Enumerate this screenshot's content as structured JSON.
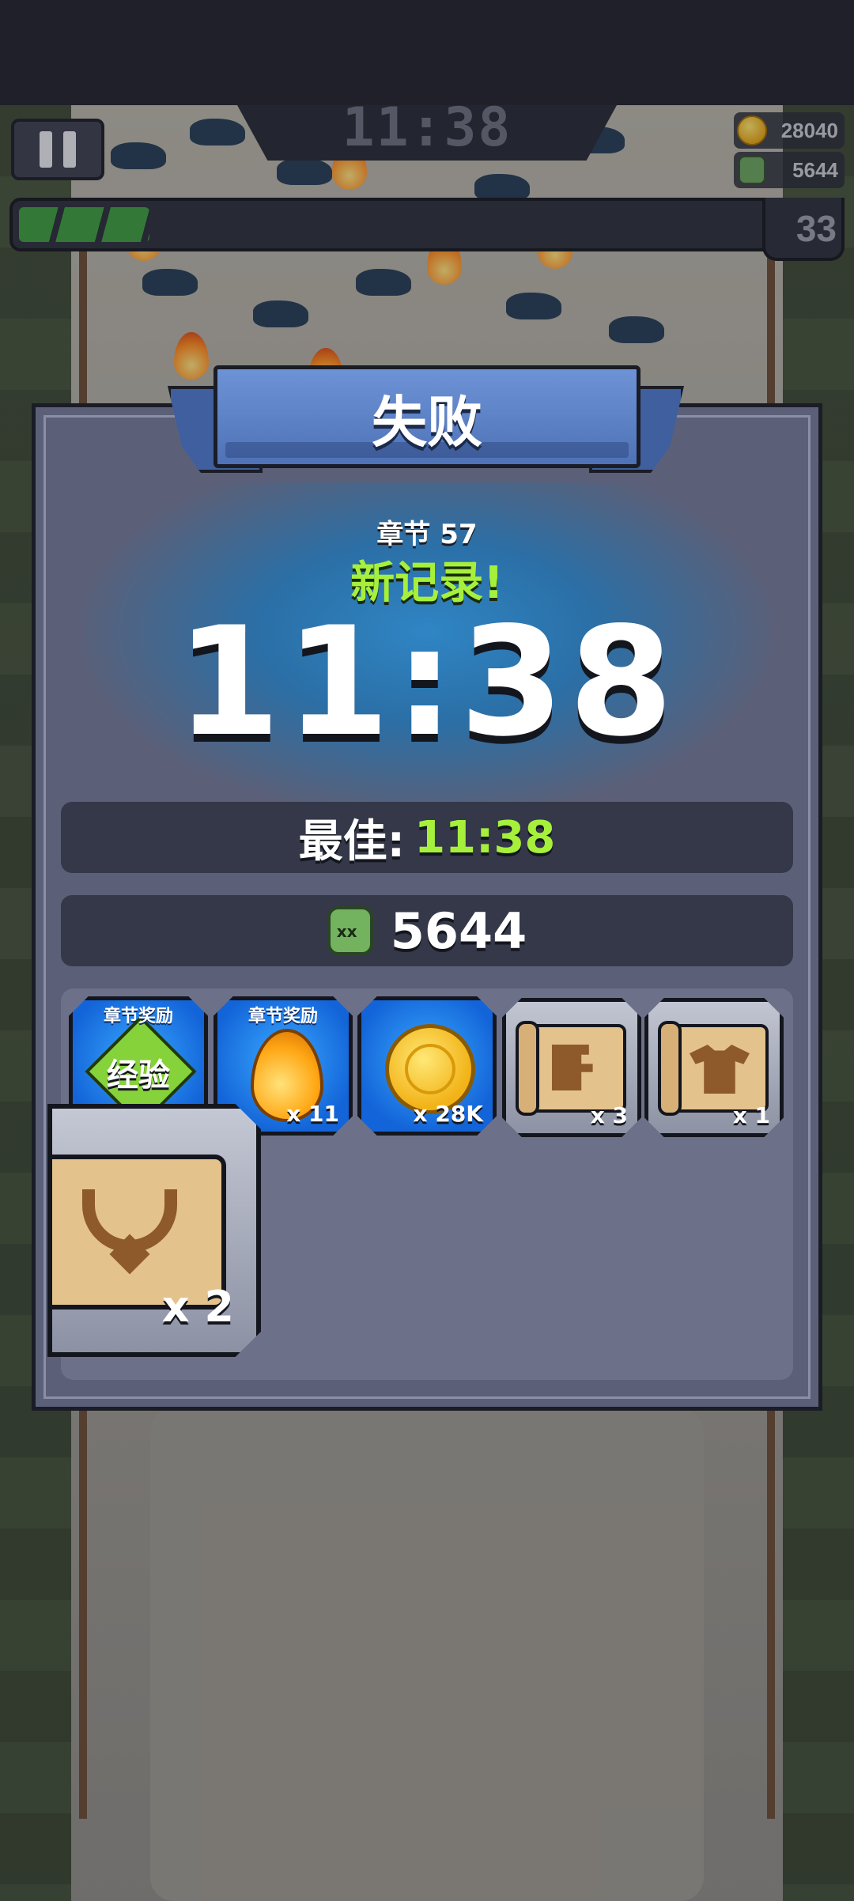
{
  "hud": {
    "timer": "11:38",
    "gold": "28040",
    "kills": "5644",
    "level": "33",
    "xp_progress_fraction": 0.16
  },
  "dialog": {
    "title": "失败",
    "chapter": "章节 57",
    "new_record": "新记录!",
    "time": "11:38",
    "best_label": "最佳:",
    "best_time": "11:38",
    "kills": "5644",
    "kills_icon_eyes": "xx"
  },
  "rewards": [
    {
      "tag": "章节奖励",
      "label": "经验",
      "qty": "",
      "icon": "xp-icon",
      "style": "blue"
    },
    {
      "tag": "章节奖励",
      "label": "",
      "qty": "x 11",
      "icon": "fuel-drop-icon",
      "style": "blue"
    },
    {
      "tag": "",
      "label": "",
      "qty": "x 28K",
      "icon": "gold-coin-icon",
      "style": "blue"
    },
    {
      "tag": "",
      "label": "",
      "qty": "x 3",
      "icon": "book-scroll-icon",
      "style": "gray"
    },
    {
      "tag": "",
      "label": "",
      "qty": "x 1",
      "icon": "armor-scroll-icon",
      "style": "gray"
    },
    {
      "tag": "",
      "label": "",
      "qty": "x 2",
      "icon": "necklace-scroll-icon",
      "style": "gray"
    }
  ],
  "colors": {
    "accent_green": "#a6f03c",
    "panel": "#5b6078",
    "ribbon": "#5b82c8",
    "reward_blue": "#1c7cf0"
  }
}
